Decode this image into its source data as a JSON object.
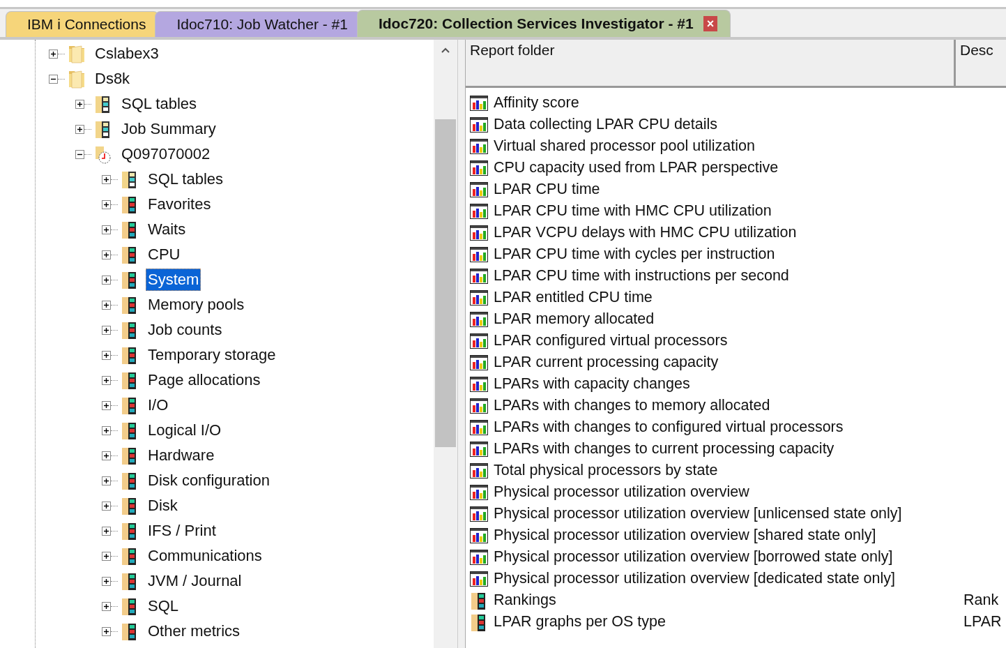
{
  "tabs": [
    {
      "label": "IBM i Connections",
      "color": "#f6d57a",
      "selected": false
    },
    {
      "label": "Idoc710:  Job Watcher - #1",
      "color": "#b4a7e0",
      "selected": false
    },
    {
      "label": "Idoc720:  Collection Services Investigator - #1",
      "color": "#b8c9a0",
      "selected": true,
      "close": "×"
    }
  ],
  "tree": [
    {
      "label": "Cslabex3",
      "kind": "folder",
      "expanded": false,
      "selected": false
    },
    {
      "label": "Ds8k",
      "kind": "folder",
      "expanded": true,
      "selected": false,
      "children": [
        {
          "label": "SQL tables",
          "kind": "database",
          "expanded": false,
          "selected": false
        },
        {
          "label": "Job Summary",
          "kind": "database",
          "expanded": false,
          "selected": false
        },
        {
          "label": "Q097070002",
          "kind": "collection",
          "expanded": true,
          "selected": false,
          "children": [
            {
              "label": "SQL tables",
              "kind": "database",
              "expanded": false,
              "selected": false
            },
            {
              "label": "Favorites",
              "kind": "reports",
              "expanded": false,
              "selected": false
            },
            {
              "label": "Waits",
              "kind": "reports",
              "expanded": false,
              "selected": false
            },
            {
              "label": "CPU",
              "kind": "reports",
              "expanded": false,
              "selected": false
            },
            {
              "label": "System",
              "kind": "reports",
              "expanded": false,
              "selected": true
            },
            {
              "label": "Memory pools",
              "kind": "reports",
              "expanded": false,
              "selected": false
            },
            {
              "label": "Job counts",
              "kind": "reports",
              "expanded": false,
              "selected": false
            },
            {
              "label": "Temporary storage",
              "kind": "reports",
              "expanded": false,
              "selected": false
            },
            {
              "label": "Page allocations",
              "kind": "reports",
              "expanded": false,
              "selected": false
            },
            {
              "label": "I/O",
              "kind": "reports",
              "expanded": false,
              "selected": false
            },
            {
              "label": "Logical I/O",
              "kind": "reports",
              "expanded": false,
              "selected": false
            },
            {
              "label": "Hardware",
              "kind": "reports",
              "expanded": false,
              "selected": false
            },
            {
              "label": "Disk configuration",
              "kind": "reports",
              "expanded": false,
              "selected": false
            },
            {
              "label": "Disk",
              "kind": "reports",
              "expanded": false,
              "selected": false
            },
            {
              "label": "IFS / Print",
              "kind": "reports",
              "expanded": false,
              "selected": false
            },
            {
              "label": "Communications",
              "kind": "reports",
              "expanded": false,
              "selected": false
            },
            {
              "label": "JVM / Journal",
              "kind": "reports",
              "expanded": false,
              "selected": false
            },
            {
              "label": "SQL",
              "kind": "reports",
              "expanded": false,
              "selected": false
            },
            {
              "label": "Other metrics",
              "kind": "reports",
              "expanded": false,
              "selected": false
            }
          ]
        }
      ]
    }
  ],
  "table": {
    "columns": [
      "Report folder",
      "Desc"
    ],
    "rows": [
      {
        "name": "Affinity score",
        "kind": "graph"
      },
      {
        "name": "Data collecting LPAR CPU details",
        "kind": "graph"
      },
      {
        "name": "Virtual shared processor pool utilization",
        "kind": "graph"
      },
      {
        "name": "CPU capacity used from LPAR perspective",
        "kind": "graph"
      },
      {
        "name": "LPAR CPU time",
        "kind": "graph"
      },
      {
        "name": "LPAR CPU time with HMC CPU utilization",
        "kind": "graph"
      },
      {
        "name": "LPAR VCPU delays with HMC CPU utilization",
        "kind": "graph"
      },
      {
        "name": "LPAR CPU time with cycles per instruction",
        "kind": "graph"
      },
      {
        "name": "LPAR CPU time with instructions per second",
        "kind": "graph"
      },
      {
        "name": "LPAR entitled CPU time",
        "kind": "graph"
      },
      {
        "name": "LPAR memory allocated",
        "kind": "graph"
      },
      {
        "name": "LPAR configured virtual processors",
        "kind": "graph"
      },
      {
        "name": "LPAR current processing capacity",
        "kind": "graph"
      },
      {
        "name": "LPARs with capacity changes",
        "kind": "graph"
      },
      {
        "name": "LPARs with changes to memory allocated",
        "kind": "graph"
      },
      {
        "name": "LPARs with changes to configured virtual processors",
        "kind": "graph"
      },
      {
        "name": "LPARs with changes to current processing capacity",
        "kind": "graph"
      },
      {
        "name": "Total physical processors by state",
        "kind": "graph"
      },
      {
        "name": "Physical processor utilization overview",
        "kind": "graph"
      },
      {
        "name": "Physical processor utilization overview [unlicensed state only]",
        "kind": "graph"
      },
      {
        "name": "Physical processor utilization overview [shared state only]",
        "kind": "graph"
      },
      {
        "name": "Physical processor utilization overview [borrowed state only]",
        "kind": "graph"
      },
      {
        "name": "Physical processor utilization overview [dedicated state only]",
        "kind": "graph"
      },
      {
        "name": "Rankings",
        "kind": "folder",
        "description": "Rank"
      },
      {
        "name": "LPAR graphs per OS type",
        "kind": "folder",
        "description": "LPAR"
      }
    ]
  }
}
